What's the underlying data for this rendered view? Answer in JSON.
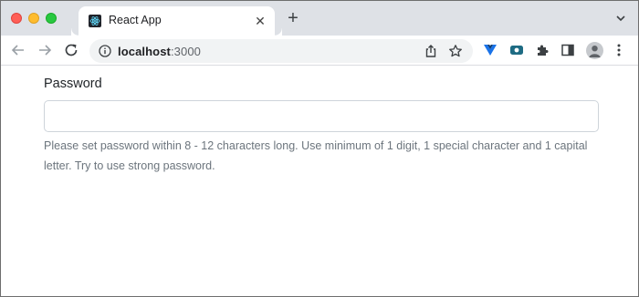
{
  "browser": {
    "tab": {
      "title": "React App",
      "close_glyph": "✕"
    },
    "new_tab_glyph": "+",
    "address": {
      "host": "localhost",
      "port": ":3000"
    }
  },
  "icons": {
    "tab_favicon": "react-icon",
    "back": "arrow-left-icon",
    "forward": "arrow-right-icon",
    "reload": "reload-icon",
    "info": "info-icon",
    "share": "share-icon",
    "bookmark": "star-icon",
    "extensions": [
      "vuejs-devtools-icon",
      "video-extension-icon",
      "puzzle-icon",
      "side-panel-icon"
    ],
    "profile": "avatar-icon",
    "menu": "kebab-menu-icon"
  },
  "colors": {
    "tabstrip": "#dee1e6",
    "help_text": "#6c757d",
    "input_border": "#ced4da"
  },
  "form": {
    "password_label": "Password",
    "password_value": "",
    "help_text": "Please set password within 8 - 12 characters long. Use minimum of 1 digit, 1 special character and 1 capital letter. Try to use strong password."
  }
}
